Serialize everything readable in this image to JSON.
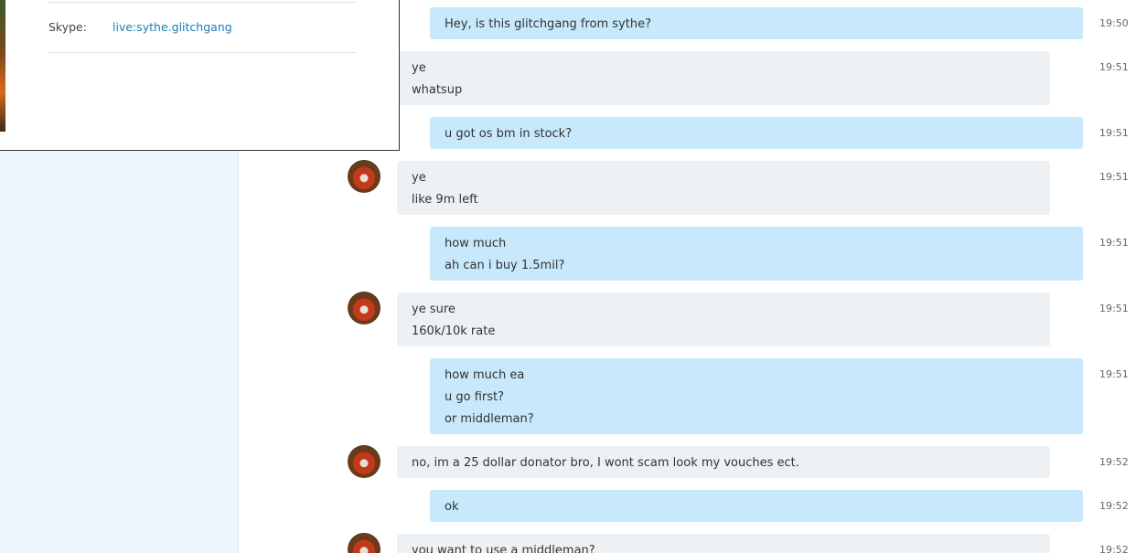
{
  "contact_card": {
    "skype_label": "Skype:",
    "skype_value": "live:sythe.glitchgang"
  },
  "messages": [
    {
      "dir": "out",
      "lines": [
        "Hey, is this glitchgang from sythe?"
      ],
      "time": "19:50"
    },
    {
      "dir": "in",
      "lines": [
        "ye",
        "whatsup"
      ],
      "time": "19:51"
    },
    {
      "dir": "out",
      "lines": [
        "u got os bm in stock?"
      ],
      "time": "19:51"
    },
    {
      "dir": "in",
      "lines": [
        "ye",
        "like 9m left"
      ],
      "time": "19:51"
    },
    {
      "dir": "out",
      "lines": [
        "how much",
        "ah can i buy 1.5mil?"
      ],
      "time": "19:51"
    },
    {
      "dir": "in",
      "lines": [
        "ye sure",
        "160k/10k rate"
      ],
      "time": "19:51"
    },
    {
      "dir": "out",
      "lines": [
        "how much ea",
        "u go first?",
        "or middleman?"
      ],
      "time": "19:51"
    },
    {
      "dir": "in",
      "lines": [
        "no, im a 25 dollar donator bro, I wont scam look my vouches ect."
      ],
      "time": "19:52"
    },
    {
      "dir": "out",
      "lines": [
        "ok"
      ],
      "time": "19:52"
    },
    {
      "dir": "in",
      "lines": [
        "you want to use a middleman?"
      ],
      "time": "19:52"
    }
  ]
}
